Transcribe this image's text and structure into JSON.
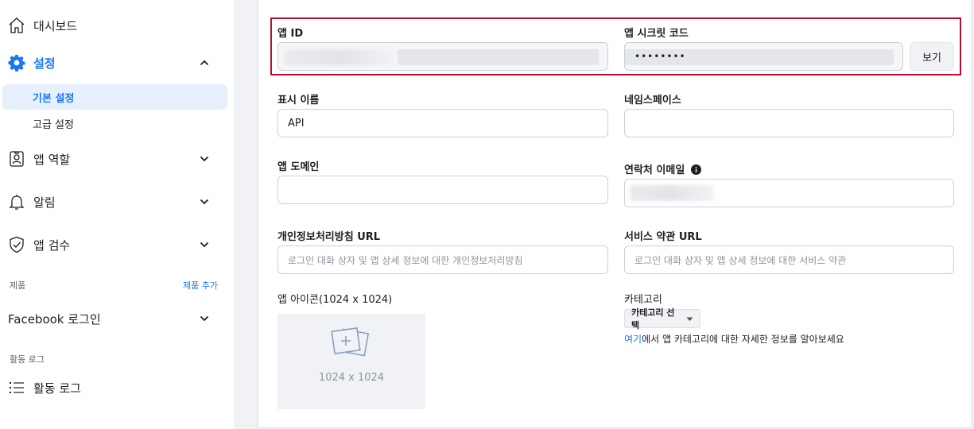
{
  "sidebar": {
    "dashboard": "대시보드",
    "settings": "설정",
    "settings_sub": {
      "basic": "기본 설정",
      "advanced": "고급 설정"
    },
    "app_roles": "앱 역할",
    "alerts": "알림",
    "app_review": "앱 검수",
    "products_label": "제품",
    "add_product": "제품 추가",
    "facebook_login": "Facebook 로그인",
    "activity_log_label": "활동 로그",
    "activity_log": "활동 로그"
  },
  "form": {
    "app_id_label": "앱 ID",
    "app_secret_label": "앱 시크릿 코드",
    "app_secret_value": "••••••••",
    "show_button": "보기",
    "display_name_label": "표시 이름",
    "display_name_value": "API",
    "namespace_label": "네임스페이스",
    "namespace_value": "",
    "app_domain_label": "앱 도메인",
    "contact_email_label": "연락처 이메일",
    "privacy_url_label": "개인정보처리방침 URL",
    "privacy_url_placeholder": "로그인 대화 상자 및 앱 상세 정보에 대한 개인정보처리방침",
    "tos_url_label": "서비스 약관 URL",
    "tos_url_placeholder": "로그인 대화 상자 및 앱 상세 정보에 대한 서비스 약관",
    "app_icon_label": "앱 아이콘(1024 x 1024)",
    "app_icon_dim": "1024 x 1024",
    "category_label": "카테고리",
    "category_button": "카테고리 선택",
    "category_help_link": "여기",
    "category_help_text": "에서 앱 카테고리에 대한 자세한 정보를 알아보세요"
  },
  "colors": {
    "accent": "#1877f2",
    "highlight_border": "#b0102d"
  }
}
